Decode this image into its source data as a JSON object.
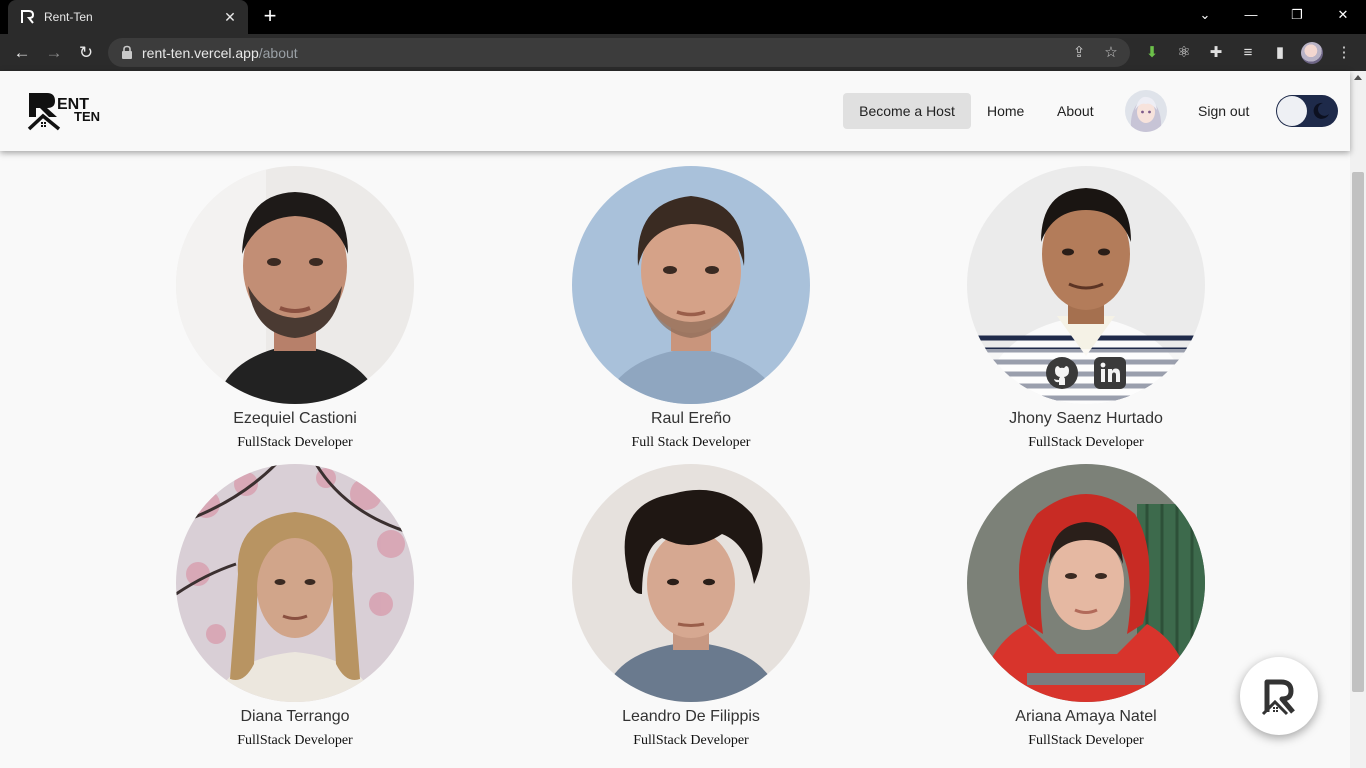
{
  "browser": {
    "tab_title": "Rent-Ten",
    "new_tab": "+",
    "url_domain": "rent-ten.vercel.app",
    "url_path": "/about"
  },
  "nav": {
    "become_host": "Become a Host",
    "home": "Home",
    "about": "About",
    "sign_out": "Sign out",
    "logo_text": "RENT TEN"
  },
  "team": [
    {
      "name": "Ezequiel Castioni",
      "role": "FullStack Developer"
    },
    {
      "name": "Raul Ereño",
      "role": "Full Stack Developer"
    },
    {
      "name": "Jhony Saenz Hurtado",
      "role": "FullStack Developer"
    },
    {
      "name": "Diana Terrango",
      "role": "FullStack Developer"
    },
    {
      "name": "Leandro De Filippis",
      "role": "FullStack Developer"
    },
    {
      "name": "Ariana Amaya Natel",
      "role": "FullStack Developer"
    }
  ],
  "colors": {
    "page_bg": "#f9f9f9",
    "host_button_bg": "#e0e0e0",
    "toggle_bg": "#1e2a4a",
    "chrome_dark": "#2b2b2b"
  }
}
